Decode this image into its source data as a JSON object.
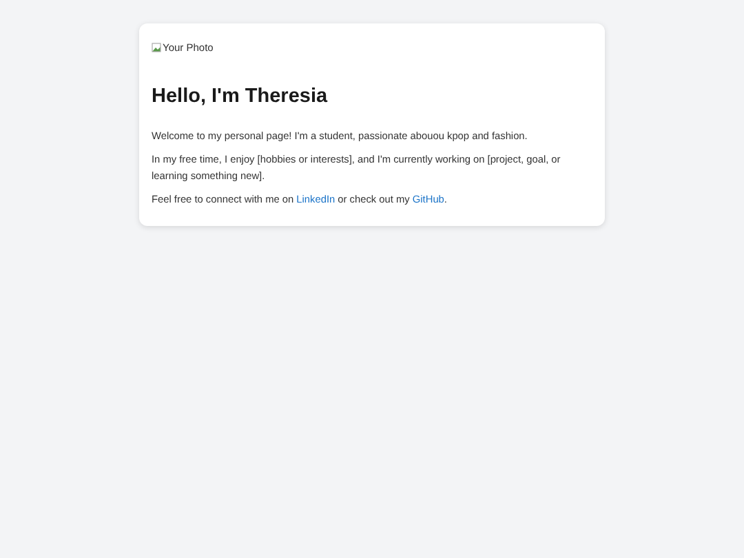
{
  "card": {
    "photo": {
      "alt": "Your Photo"
    },
    "heading": "Hello, I'm Theresia",
    "paragraphs": [
      {
        "parts": [
          {
            "kind": "text",
            "text": "Welcome to my personal page! I'm a student, passionate abouou kpop and fashion."
          }
        ]
      },
      {
        "parts": [
          {
            "kind": "text",
            "text": "In my free time, I enjoy [hobbies or interests], and I'm currently working on [project, goal, or learning something new]."
          }
        ]
      },
      {
        "parts": [
          {
            "kind": "text",
            "text": "Feel free to connect with me on "
          },
          {
            "kind": "link",
            "text": "LinkedIn"
          },
          {
            "kind": "text",
            "text": " or check out my "
          },
          {
            "kind": "link",
            "text": "GitHub"
          },
          {
            "kind": "text",
            "text": "."
          }
        ]
      }
    ]
  }
}
